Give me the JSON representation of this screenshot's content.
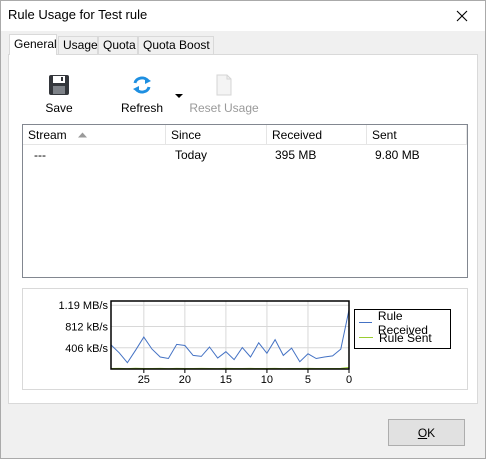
{
  "window": {
    "title": "Rule Usage for Test rule"
  },
  "tabs": [
    {
      "label": "General",
      "active": true
    },
    {
      "label": "Usage",
      "active": false
    },
    {
      "label": "Quota",
      "active": false
    },
    {
      "label": "Quota Boost",
      "active": false
    }
  ],
  "toolbar": {
    "save_label": "Save",
    "refresh_label": "Refresh",
    "reset_label": "Reset Usage",
    "icons": {
      "save": "floppy-disk-icon",
      "refresh": "refresh-arrows-icon",
      "dropdown": "dropdown-arrow-icon",
      "reset": "blank-document-icon"
    }
  },
  "table": {
    "columns": [
      "Stream",
      "Since",
      "Received",
      "Sent"
    ],
    "sort_column": "Stream",
    "sort_direction": "ascending",
    "rows": [
      {
        "stream": "---",
        "since": "Today",
        "received": "395 MB",
        "sent": "9.80 MB"
      }
    ]
  },
  "chart_data": {
    "type": "line",
    "y_tick_labels": [
      "1.19 MB/s",
      "812 kB/s",
      "406 kB/s"
    ],
    "y_tick_values_kBps": [
      1219,
      812,
      406
    ],
    "x_tick_labels": [
      "25",
      "20",
      "15",
      "10",
      "5",
      "0"
    ],
    "x_tick_values": [
      25,
      20,
      15,
      10,
      5,
      0
    ],
    "xlim": [
      29,
      0
    ],
    "ylim": [
      0,
      1300
    ],
    "grid": true,
    "legend_placement": "right",
    "series": [
      {
        "name": "Rule Received",
        "color": "#4472c4",
        "x": [
          29,
          28,
          27,
          26,
          25,
          24,
          23,
          22,
          21,
          20,
          19,
          18,
          17,
          16,
          15,
          14,
          13,
          12,
          11,
          10,
          9,
          8,
          7,
          6,
          5,
          4,
          3,
          2,
          1,
          0
        ],
        "values": [
          460,
          310,
          120,
          360,
          610,
          380,
          230,
          200,
          470,
          450,
          260,
          240,
          420,
          210,
          330,
          180,
          410,
          230,
          500,
          300,
          560,
          260,
          400,
          140,
          290,
          200,
          230,
          250,
          380,
          1130
        ]
      },
      {
        "name": "Rule Sent",
        "color": "#9acd32",
        "x": [
          29,
          28,
          27,
          26,
          25,
          24,
          23,
          22,
          21,
          20,
          19,
          18,
          17,
          16,
          15,
          14,
          13,
          12,
          11,
          10,
          9,
          8,
          7,
          6,
          5,
          4,
          3,
          2,
          1,
          0
        ],
        "values": [
          10,
          12,
          8,
          14,
          10,
          9,
          11,
          8,
          12,
          10,
          9,
          11,
          10,
          8,
          12,
          9,
          10,
          11,
          9,
          10,
          12,
          8,
          10,
          9,
          11,
          10,
          9,
          10,
          12,
          30
        ]
      }
    ]
  },
  "buttons": {
    "ok_prefix": "",
    "ok_underlined": "O",
    "ok_suffix": "K"
  }
}
